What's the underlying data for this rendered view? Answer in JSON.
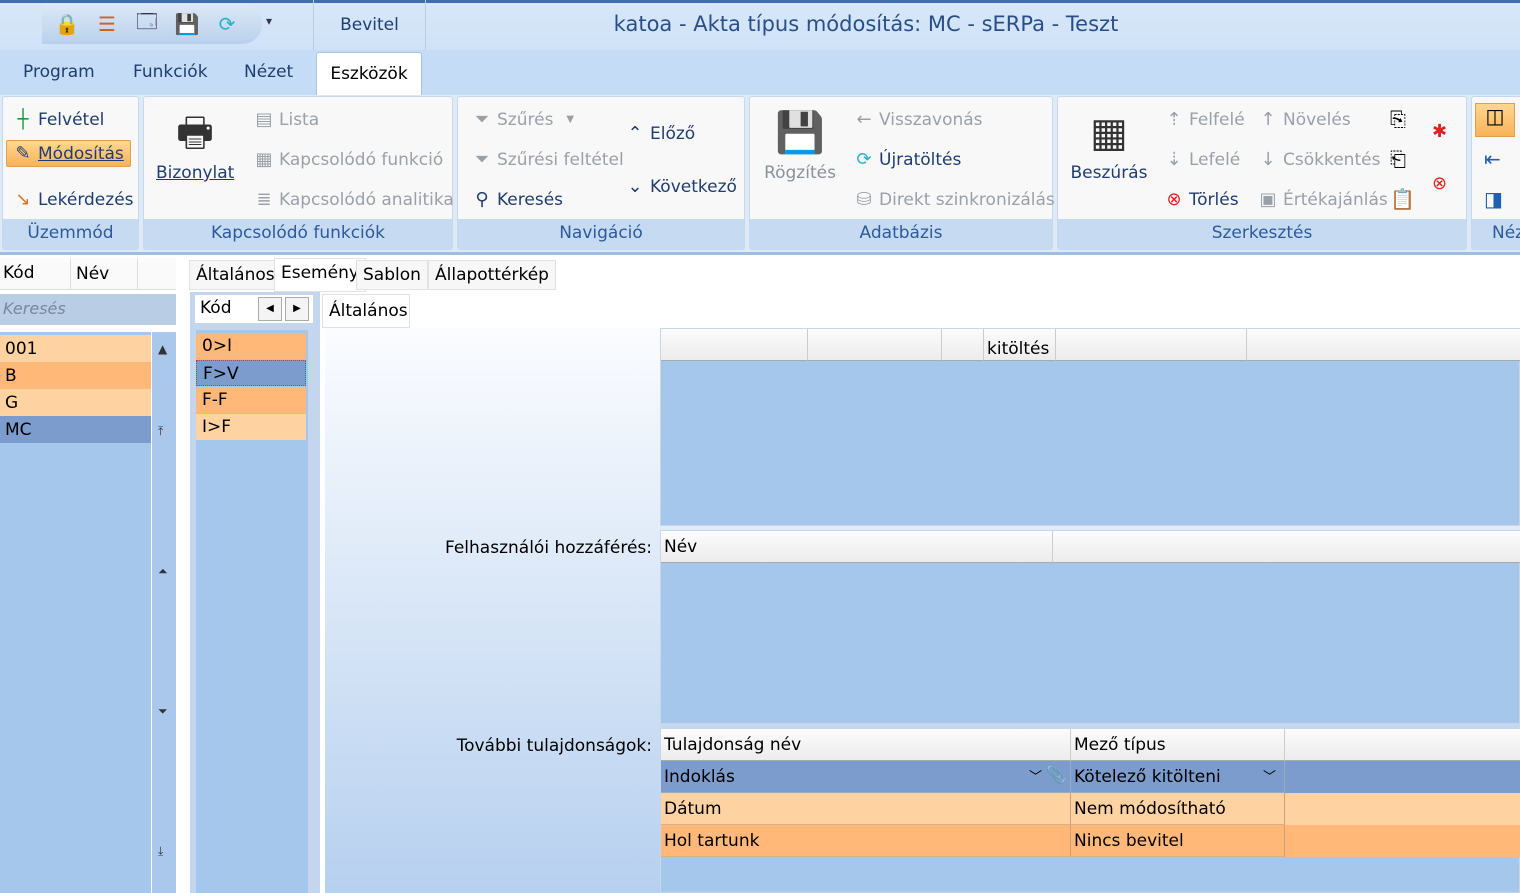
{
  "window": {
    "title": "katoa - Akta típus módosítás: MC - sERPa - Teszt",
    "context_tab": "Bevitel"
  },
  "qat": {
    "icons": [
      "lock-icon",
      "tree-icon",
      "preview-icon",
      "save-icon",
      "refresh-icon"
    ],
    "more": "▾"
  },
  "ribbon_tabs": [
    "Program",
    "Funkciók",
    "Nézet",
    "Eszközök"
  ],
  "groups": {
    "uzemmod": {
      "label": "Üzemmód",
      "felvetel": "Felvétel",
      "modositas": "Módosítás",
      "lekerdezes": "Lekérdezés"
    },
    "kapcsolodo": {
      "label": "Kapcsolódó funkciók",
      "bizonylat": "Bizonylat",
      "lista": "Lista",
      "funkcio": "Kapcsolódó funkció",
      "analitika": "Kapcsolódó analitika"
    },
    "navigacio": {
      "label": "Navigáció",
      "szures": "Szűrés",
      "szuresi_feltetel": "Szűrési feltétel",
      "kereses": "Keresés",
      "elozo": "Előző",
      "kovetkezo": "Következő"
    },
    "adatbazis": {
      "label": "Adatbázis",
      "rogzites": "Rögzítés",
      "visszavonas": "Visszavonás",
      "ujratoltes": "Újratöltés",
      "direkt": "Direkt szinkronizálás"
    },
    "szerkesztes": {
      "label": "Szerkesztés",
      "beszuras": "Beszúrás",
      "felfele": "Felfelé",
      "lefele": "Lefelé",
      "torles": "Törlés",
      "noveles": "Növelés",
      "csokkentes": "Csökkentés",
      "ertekajanlas": "Értékajánlás"
    },
    "nezet": {
      "label": "Néz"
    }
  },
  "list": {
    "col_kod": "Kód",
    "col_nev": "Név",
    "search_placeholder": "Keresés",
    "rows": [
      "001",
      "B",
      "G",
      "MC"
    ]
  },
  "detail_tabs": [
    "Általános",
    "Esemény",
    "Sablon",
    "Állapottérkép"
  ],
  "events": {
    "col_kod": "Kód",
    "rows": [
      "0>I",
      "F>V",
      "F-F",
      "I>F"
    ]
  },
  "main": {
    "tab": "Általános",
    "top_grid_header": "kitöltés",
    "user_access_label": "Felhasználói hozzáférés:",
    "user_access_col": "Név",
    "props_label": "További tulajdonságok:",
    "props_cols": [
      "Tulajdonság név",
      "Mező típus"
    ],
    "props_rows": [
      {
        "name": "Indoklás",
        "type": "Kötelező kitölteni"
      },
      {
        "name": "Dátum",
        "type": "Nem módosítható"
      },
      {
        "name": "Hol tartunk",
        "type": "Nincs bevitel"
      }
    ]
  },
  "colors": {
    "selected": "#7b9ccc",
    "row_light": "#ffd2a2",
    "row_dark": "#ffb877",
    "grid_bg": "#a6c7ec"
  }
}
